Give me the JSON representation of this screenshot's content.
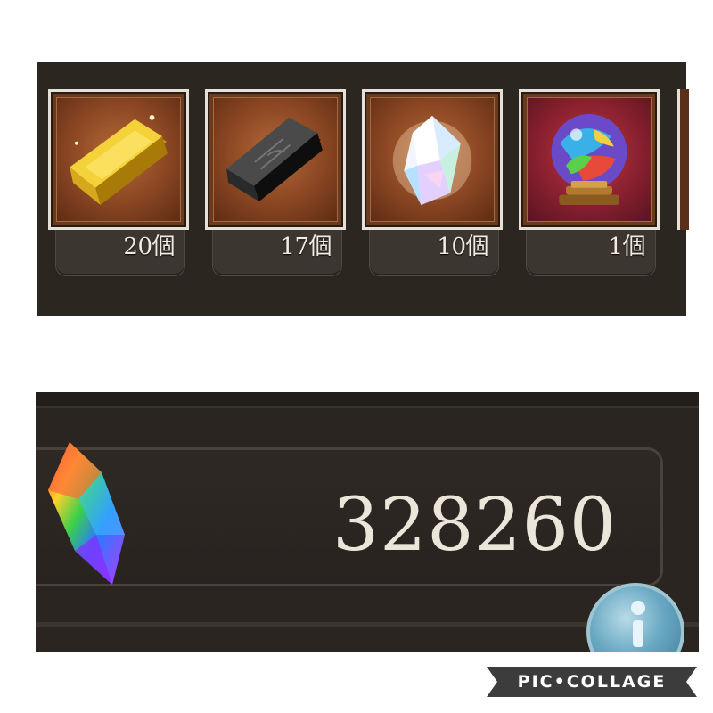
{
  "inventory": {
    "items": [
      {
        "icon": "gold-bar-icon",
        "count": "20個"
      },
      {
        "icon": "black-bar-icon",
        "count": "17個"
      },
      {
        "icon": "crystal-icon",
        "count": "10個"
      },
      {
        "icon": "crystal-ball-icon",
        "count": "1個"
      }
    ]
  },
  "currency": {
    "icon": "rainbow-gem-icon",
    "value": "328260",
    "info_icon": "info-icon"
  },
  "watermark": {
    "text": "PIC•COLLAGE"
  },
  "colors": {
    "panel_bg": "#2b2620",
    "frame_border": "#e6e1d8",
    "item_bg": "#8a4623",
    "count_text": "#f2ece0",
    "info_button": "#6aa9c3",
    "watermark_bg": "#3c3c3c"
  }
}
